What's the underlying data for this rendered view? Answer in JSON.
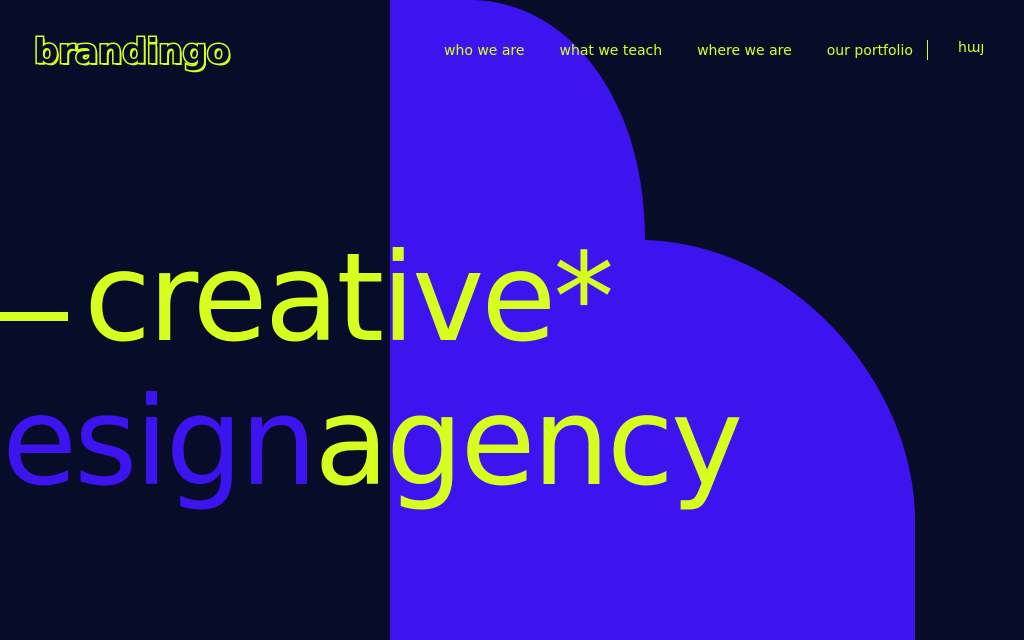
{
  "brand": {
    "logo_text": "brandingo"
  },
  "nav": {
    "links": [
      {
        "label": "who we are"
      },
      {
        "label": "what we teach"
      },
      {
        "label": "where we are"
      },
      {
        "label": "our portfolio"
      }
    ],
    "language_label": "հայ"
  },
  "hero": {
    "line1": "creative*",
    "line2_part1": "esign",
    "line2_part2": "agency"
  },
  "colors": {
    "background": "#070d29",
    "accent": "#d6ff1f",
    "secondary": "#3d14f0"
  }
}
